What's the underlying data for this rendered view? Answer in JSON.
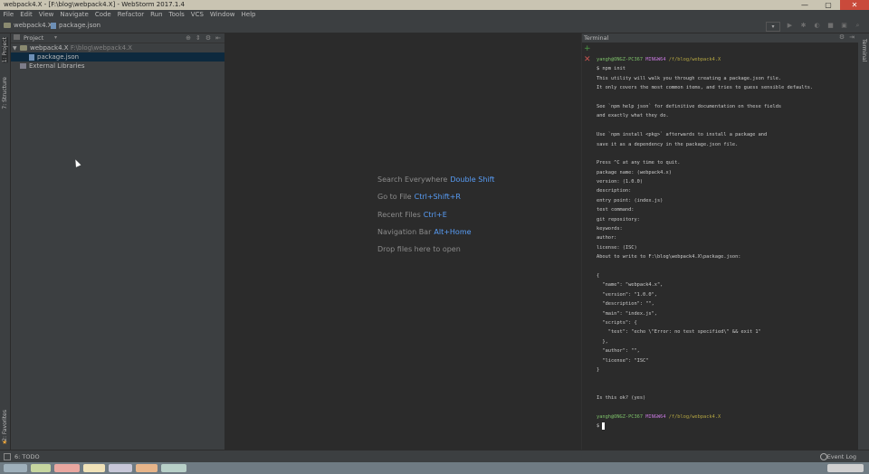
{
  "window": {
    "title": "webpack4.X - [F:\\blog\\webpack4.X] - WebStorm 2017.1.4",
    "controls": [
      "—",
      "▢",
      "✕"
    ]
  },
  "menu": [
    "File",
    "Edit",
    "View",
    "Navigate",
    "Code",
    "Refactor",
    "Run",
    "Tools",
    "VCS",
    "Window",
    "Help"
  ],
  "breadcrumb": {
    "project": "webpack4.X",
    "file": "package.json"
  },
  "left_stripe": {
    "project_label": "1: Project",
    "structure_label": "7: Structure",
    "favorites_label": "2: Favorites"
  },
  "project_panel": {
    "header": "Project",
    "tree": [
      {
        "name": "webpack4.X",
        "path": "F:\\blog\\webpack4.X"
      },
      {
        "name": "package.json"
      },
      {
        "name": "External Libraries"
      }
    ]
  },
  "editor": {
    "hints": [
      {
        "label": "Search Everywhere",
        "key": "Double Shift"
      },
      {
        "label": "Go to File",
        "key": "Ctrl+Shift+R"
      },
      {
        "label": "Recent Files",
        "key": "Ctrl+E"
      },
      {
        "label": "Navigation Bar",
        "key": "Alt+Home"
      },
      {
        "label": "Drop files here to open",
        "key": ""
      }
    ]
  },
  "terminal": {
    "title": "Terminal",
    "prompt": {
      "user": "yangh@ONGZ-PC367",
      "host": "MINGW64",
      "path": "/f/blog/webpack4.X"
    },
    "lines": [
      "$ npm init",
      "This utility will walk you through creating a package.json file.",
      "It only covers the most common items, and tries to guess sensible defaults.",
      "",
      "See `npm help json` for definitive documentation on these fields",
      "and exactly what they do.",
      "",
      "Use `npm install <pkg>` afterwards to install a package and",
      "save it as a dependency in the package.json file.",
      "",
      "Press ^C at any time to quit.",
      "package name: (webpack4.x)",
      "version: (1.0.0)",
      "description:",
      "entry point: (index.js)",
      "test command:",
      "git repository:",
      "keywords:",
      "author:",
      "license: (ISC)",
      "About to write to F:\\blog\\webpack4.X\\package.json:",
      "",
      "{",
      "  \"name\": \"webpack4.x\",",
      "  \"version\": \"1.0.0\",",
      "  \"description\": \"\",",
      "  \"main\": \"index.js\",",
      "  \"scripts\": {",
      "    \"test\": \"echo \\\"Error: no test specified\\\" && exit 1\"",
      "  },",
      "  \"author\": \"\",",
      "  \"license\": \"ISC\"",
      "}",
      "",
      "",
      "Is this ok? (yes)",
      ""
    ],
    "final_prompt_symbol": "$"
  },
  "right_stripe": {
    "label": "Terminal"
  },
  "status": {
    "todo": "6: TODO",
    "event_log": "Event Log"
  },
  "colors": {
    "accent_key": "#589df6",
    "selection": "#0d293e",
    "prompt_user": "#7ec26a",
    "prompt_host": "#c678dd",
    "prompt_path": "#b5a642"
  }
}
